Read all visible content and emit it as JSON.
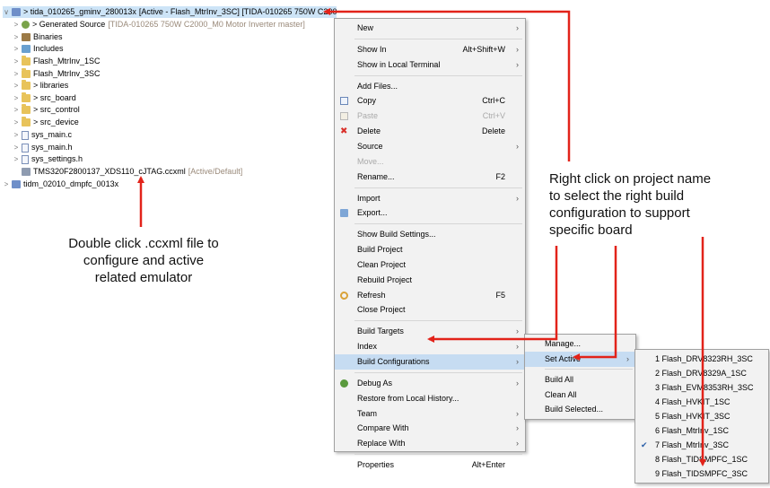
{
  "tree": {
    "rows": [
      {
        "label": "> tida_010265_gminv_280013x",
        "extra": "[Active - Flash_MtrInv_3SC] [TIDA-010265 750W C200",
        "icon": "proj",
        "depth": 0,
        "chev": "v"
      },
      {
        "label": "> Generated Source",
        "extra": "[TIDA-010265 750W C2000_M0 Motor Inverter master]",
        "icon": "gear",
        "depth": 1,
        "chev": ">"
      },
      {
        "label": "Binaries",
        "extra": "",
        "icon": "bin",
        "depth": 1,
        "chev": ">"
      },
      {
        "label": "Includes",
        "extra": "",
        "icon": "inc",
        "depth": 1,
        "chev": ">"
      },
      {
        "label": "Flash_MtrInv_1SC",
        "extra": "",
        "icon": "folder",
        "depth": 1,
        "chev": ">"
      },
      {
        "label": "Flash_MtrInv_3SC",
        "extra": "",
        "icon": "folder",
        "depth": 1,
        "chev": ">"
      },
      {
        "label": "> libraries",
        "extra": "",
        "icon": "folder",
        "depth": 1,
        "chev": ">"
      },
      {
        "label": "> src_board",
        "extra": "",
        "icon": "folder",
        "depth": 1,
        "chev": ">"
      },
      {
        "label": "> src_control",
        "extra": "",
        "icon": "folder",
        "depth": 1,
        "chev": ">"
      },
      {
        "label": "> src_device",
        "extra": "",
        "icon": "folder",
        "depth": 1,
        "chev": ">"
      },
      {
        "label": "sys_main.c",
        "extra": "",
        "icon": "file",
        "depth": 1,
        "chev": ">"
      },
      {
        "label": "sys_main.h",
        "extra": "",
        "icon": "file",
        "depth": 1,
        "chev": ">"
      },
      {
        "label": "sys_settings.h",
        "extra": "",
        "icon": "file",
        "depth": 1,
        "chev": ">"
      },
      {
        "label": "TMS320F2800137_XDS110_cJTAG.ccxml",
        "extra": "[Active/Default]",
        "icon": "ccx",
        "depth": 1,
        "chev": ""
      },
      {
        "label": "tidm_02010_dmpfc_0013x",
        "extra": "",
        "icon": "proj",
        "depth": 0,
        "chev": ">"
      }
    ]
  },
  "context_menu": {
    "items": [
      {
        "label": "New",
        "shortcut": "",
        "submenu": true,
        "disabled": false
      },
      {
        "sep": true
      },
      {
        "label": "Show In",
        "shortcut": "Alt+Shift+W",
        "submenu": true,
        "disabled": false
      },
      {
        "label": "Show in Local Terminal",
        "shortcut": "",
        "submenu": true,
        "disabled": false
      },
      {
        "sep": true
      },
      {
        "label": "Add Files...",
        "shortcut": "",
        "submenu": false,
        "disabled": false
      },
      {
        "label": "Copy",
        "shortcut": "Ctrl+C",
        "submenu": false,
        "disabled": false,
        "icon": "copy-icon"
      },
      {
        "label": "Paste",
        "shortcut": "Ctrl+V",
        "submenu": false,
        "disabled": true,
        "icon": "paste-icon"
      },
      {
        "label": "Delete",
        "shortcut": "Delete",
        "submenu": false,
        "disabled": false,
        "icon": "delete-icon"
      },
      {
        "label": "Source",
        "shortcut": "",
        "submenu": true,
        "disabled": false
      },
      {
        "label": "Move...",
        "shortcut": "",
        "submenu": false,
        "disabled": true
      },
      {
        "label": "Rename...",
        "shortcut": "F2",
        "submenu": false,
        "disabled": false
      },
      {
        "sep": true
      },
      {
        "label": "Import",
        "shortcut": "",
        "submenu": true,
        "disabled": false
      },
      {
        "label": "Export...",
        "shortcut": "",
        "submenu": false,
        "disabled": false,
        "icon": "export-icon"
      },
      {
        "sep": true
      },
      {
        "label": "Show Build Settings...",
        "shortcut": "",
        "submenu": false,
        "disabled": false
      },
      {
        "label": "Build Project",
        "shortcut": "",
        "submenu": false,
        "disabled": false
      },
      {
        "label": "Clean Project",
        "shortcut": "",
        "submenu": false,
        "disabled": false
      },
      {
        "label": "Rebuild Project",
        "shortcut": "",
        "submenu": false,
        "disabled": false
      },
      {
        "label": "Refresh",
        "shortcut": "F5",
        "submenu": false,
        "disabled": false,
        "icon": "refresh-icon"
      },
      {
        "label": "Close Project",
        "shortcut": "",
        "submenu": false,
        "disabled": false
      },
      {
        "sep": true
      },
      {
        "label": "Build Targets",
        "shortcut": "",
        "submenu": true,
        "disabled": false
      },
      {
        "label": "Index",
        "shortcut": "",
        "submenu": true,
        "disabled": false
      },
      {
        "label": "Build Configurations",
        "shortcut": "",
        "submenu": true,
        "disabled": false,
        "highlight": true
      },
      {
        "sep": true
      },
      {
        "label": "Debug As",
        "shortcut": "",
        "submenu": true,
        "disabled": false,
        "icon": "debug-icon"
      },
      {
        "label": "Restore from Local History...",
        "shortcut": "",
        "submenu": false,
        "disabled": false
      },
      {
        "label": "Team",
        "shortcut": "",
        "submenu": true,
        "disabled": false
      },
      {
        "label": "Compare With",
        "shortcut": "",
        "submenu": true,
        "disabled": false
      },
      {
        "label": "Replace With",
        "shortcut": "",
        "submenu": true,
        "disabled": false
      },
      {
        "sep": true
      },
      {
        "label": "Properties",
        "shortcut": "Alt+Enter",
        "submenu": false,
        "disabled": false
      }
    ]
  },
  "build_config_menu": {
    "items": [
      {
        "label": "Manage...",
        "submenu": false
      },
      {
        "label": "Set Active",
        "submenu": true,
        "highlight": true
      },
      {
        "sep": true
      },
      {
        "label": "Build All",
        "submenu": false
      },
      {
        "label": "Clean All",
        "submenu": false
      },
      {
        "label": "Build Selected...",
        "submenu": false
      }
    ]
  },
  "set_active_menu": {
    "items": [
      {
        "label": "1 Flash_DRV8323RH_3SC",
        "checked": false
      },
      {
        "label": "2 Flash_DRV8329A_1SC",
        "checked": false
      },
      {
        "label": "3 Flash_EVM8353RH_3SC",
        "checked": false
      },
      {
        "label": "4 Flash_HVKIT_1SC",
        "checked": false
      },
      {
        "label": "5 Flash_HVKIT_3SC",
        "checked": false
      },
      {
        "label": "6 Flash_MtrInv_1SC",
        "checked": false
      },
      {
        "label": "7 Flash_MtrInv_3SC",
        "checked": true
      },
      {
        "label": "8 Flash_TIDSMPFC_1SC",
        "checked": false
      },
      {
        "label": "9 Flash_TIDSMPFC_3SC",
        "checked": false
      }
    ]
  },
  "annotations": {
    "left": [
      "Double click .ccxml file to",
      "configure and active",
      "related emulator"
    ],
    "right": [
      "Right click on project name",
      "to select the right build",
      "configuration to support",
      "specific board"
    ]
  },
  "colors": {
    "arrow": "#e2231a",
    "highlight": "#c6dcf2",
    "selected_row": "#cde4f7"
  }
}
